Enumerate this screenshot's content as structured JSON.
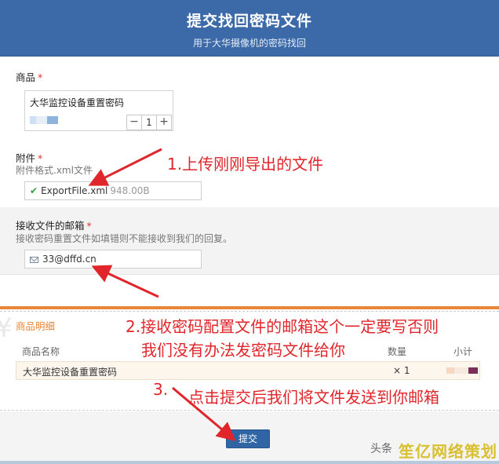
{
  "header": {
    "title": "提交找回密码文件",
    "subtitle": "用于大华摄像机的密码找回"
  },
  "product": {
    "label": "商品",
    "required_mark": "*",
    "name": "大华监控设备重置密码",
    "quantity": "1",
    "minus": "−",
    "plus": "+"
  },
  "attachment": {
    "label": "附件",
    "required_mark": "*",
    "hint": "附件格式.xml文件",
    "file_name": "ExportFile.xml",
    "file_size": "948.00B"
  },
  "email": {
    "label": "接收文件的邮箱",
    "required_mark": "*",
    "hint": "接收密码重置文件如填错则不能接收到我们的回复。",
    "value": "33@dffd.cn"
  },
  "details": {
    "title": "商品明细",
    "headers": {
      "name": "商品名称",
      "qty": "数量",
      "subtotal": "小计"
    },
    "row": {
      "name": "大华监控设备重置密码",
      "qty": "× 1"
    }
  },
  "submit_label": "提交",
  "annotations": {
    "step1": "1.上传刚刚导出的文件",
    "step2_line1": "2.接收密码配置文件的邮箱这个一定要写否则",
    "step2_line2": "我们没有办法发密码文件给你",
    "step3_num": "3.",
    "step3": "点击提交后我们将文件发送到你邮箱"
  },
  "watermark": {
    "source": "头条",
    "brand": "笙亿网络策划"
  },
  "colors": {
    "header_bg": "#3c6aa8",
    "accent_orange": "#e8863a",
    "annotation_red": "#e0262b",
    "submit_bg": "#2f64a5"
  }
}
